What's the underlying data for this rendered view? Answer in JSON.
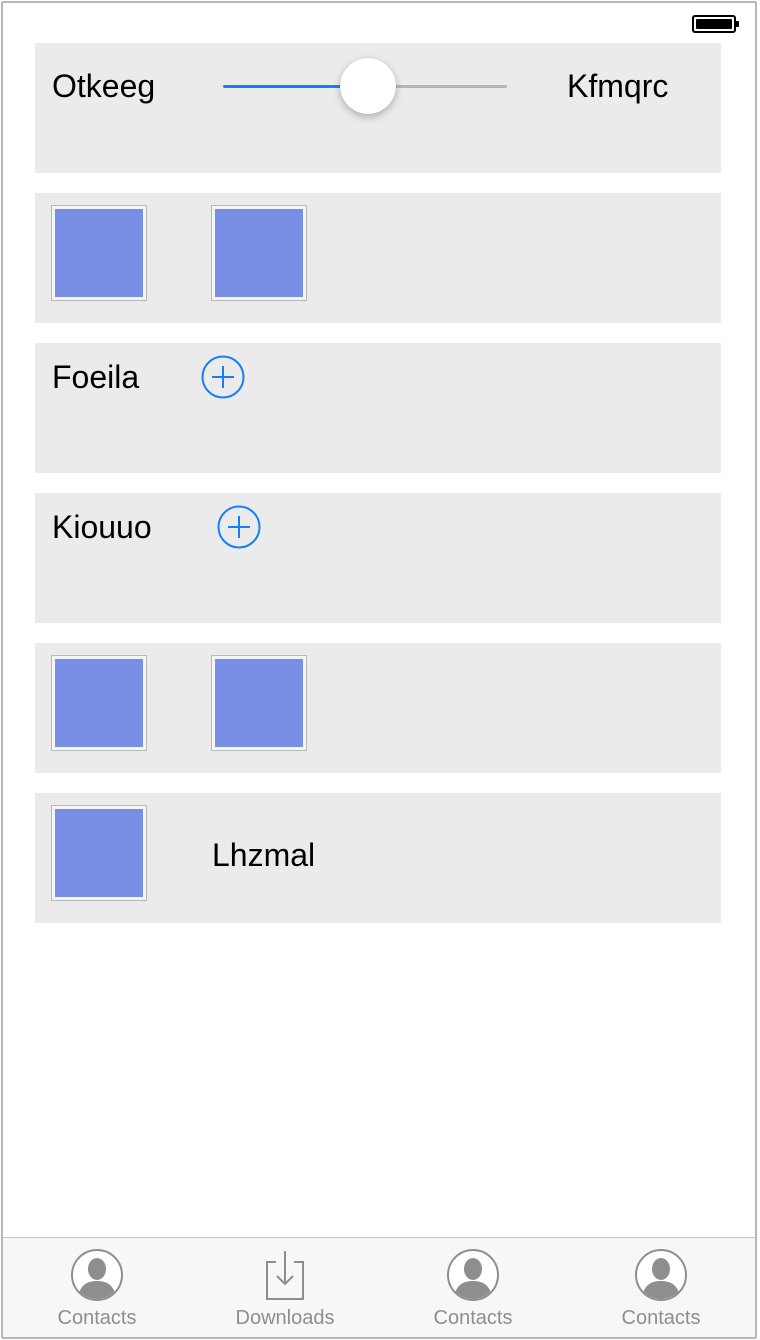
{
  "status_bar": {
    "battery": "full"
  },
  "slider_row": {
    "min_label": "Otkeeg",
    "max_label": "Kfmqrc",
    "value": 0.51,
    "colors": {
      "min_track": "#157efb",
      "max_track": "#b7b7b7"
    }
  },
  "rows": {
    "foeila": {
      "label": "Foeila",
      "icon": "plus-circle-icon"
    },
    "kiouuo": {
      "label": "Kiouuo",
      "icon": "plus-circle-icon"
    },
    "lhzmal": {
      "label": "Lhzmal"
    }
  },
  "colors": {
    "card_bg": "#ebebeb",
    "thumbnail_fill": "#798ee5",
    "accent": "#157efb",
    "tab_label": "#8e8e8e"
  },
  "tab_bar": {
    "tabs": [
      {
        "label": "Contacts",
        "icon": "contacts-icon"
      },
      {
        "label": "Downloads",
        "icon": "downloads-icon"
      },
      {
        "label": "Contacts",
        "icon": "contacts-icon"
      },
      {
        "label": "Contacts",
        "icon": "contacts-icon"
      }
    ]
  }
}
